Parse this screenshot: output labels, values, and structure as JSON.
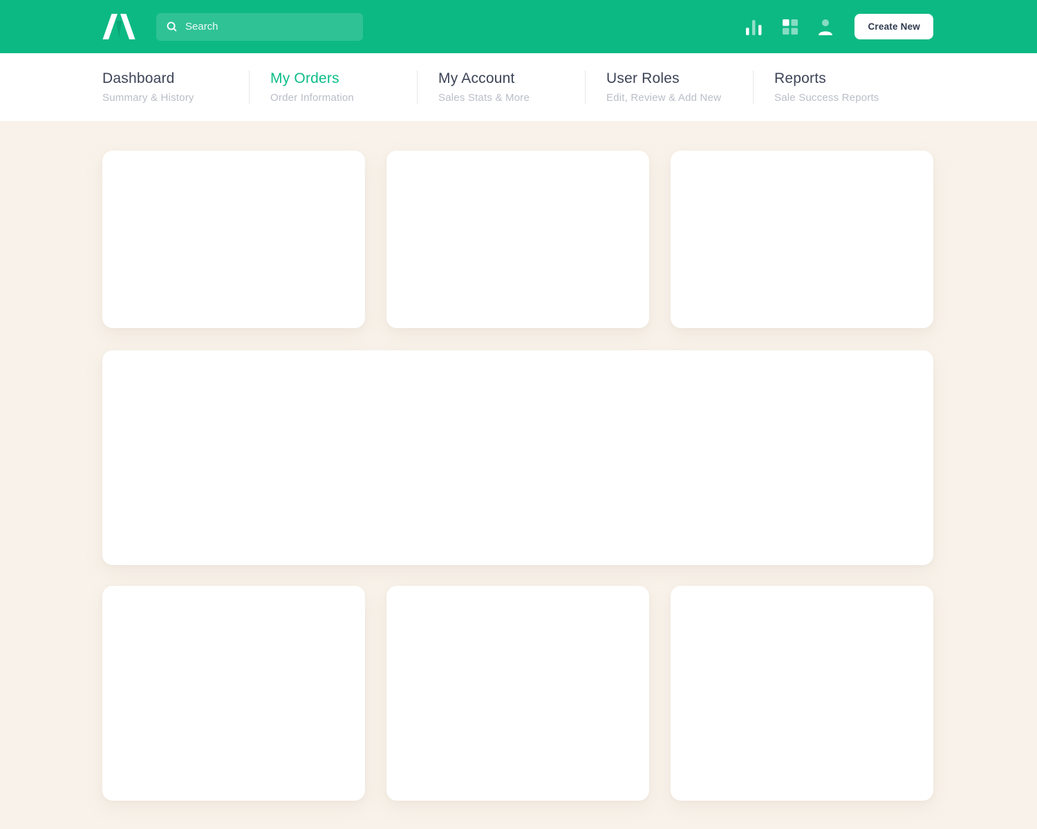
{
  "header": {
    "search_placeholder": "Search",
    "create_button_label": "Create New",
    "icons": [
      "brand-logo",
      "search-icon",
      "bar-chart-icon",
      "grid-apps-icon",
      "user-profile-icon"
    ]
  },
  "nav": {
    "tabs": [
      {
        "label": "Dashboard",
        "sublabel": "Summary & History",
        "active": false
      },
      {
        "label": "My Orders",
        "sublabel": "Order Information",
        "active": true
      },
      {
        "label": "My Account",
        "sublabel": "Sales Stats & More",
        "active": false
      },
      {
        "label": "User Roles",
        "sublabel": "Edit, Review & Add New",
        "active": false
      },
      {
        "label": "Reports",
        "sublabel": "Sale Success Reports",
        "active": false
      }
    ]
  },
  "content": {
    "cards": [
      "card-top-1",
      "card-top-2",
      "card-top-3",
      "card-wide",
      "card-bottom-1",
      "card-bottom-2",
      "card-bottom-3"
    ]
  },
  "colors": {
    "header_green": "#0db983",
    "active_tab_green": "#0dbd88",
    "background_cream": "#f8f2ea",
    "card_white": "#ffffff",
    "heading_dark": "#3d4457",
    "subtitle_gray": "#b9bdc7",
    "button_text_dark": "#2e3a4e"
  }
}
